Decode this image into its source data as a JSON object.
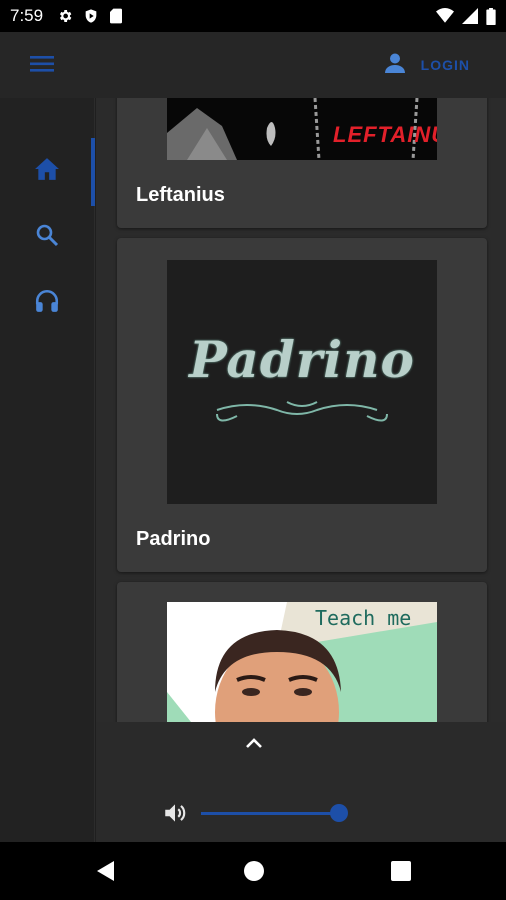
{
  "status_bar": {
    "time": "7:59",
    "left_icons": [
      "settings-icon",
      "play-protect-icon",
      "sd-card-icon"
    ],
    "right_icons": [
      "wifi-icon",
      "signal-icon",
      "battery-icon"
    ]
  },
  "app_bar": {
    "menu_icon": "menu-icon",
    "user_icon": "user-icon",
    "login_label": "LOGIN"
  },
  "side_rail": {
    "items": [
      {
        "icon": "home-icon",
        "active": true
      },
      {
        "icon": "search-icon",
        "active": false
      },
      {
        "icon": "headphones-icon",
        "active": false
      }
    ]
  },
  "cards": [
    {
      "title": "Leftanius",
      "art_text": "LEFTAINUS"
    },
    {
      "title": "Padrino",
      "art_text": "Padrino"
    },
    {
      "title": "",
      "art_text": "Teach me"
    }
  ],
  "player": {
    "expand_icon": "chevron-up-icon",
    "volume_icon": "volume-icon",
    "volume_level": 1.0
  },
  "nav_bar": {
    "icons": [
      "back-icon",
      "home-circle-icon",
      "recents-icon"
    ]
  },
  "colors": {
    "accent": "#1d4fa8",
    "background": "#1f1f1f",
    "card": "#3a3a3a"
  }
}
